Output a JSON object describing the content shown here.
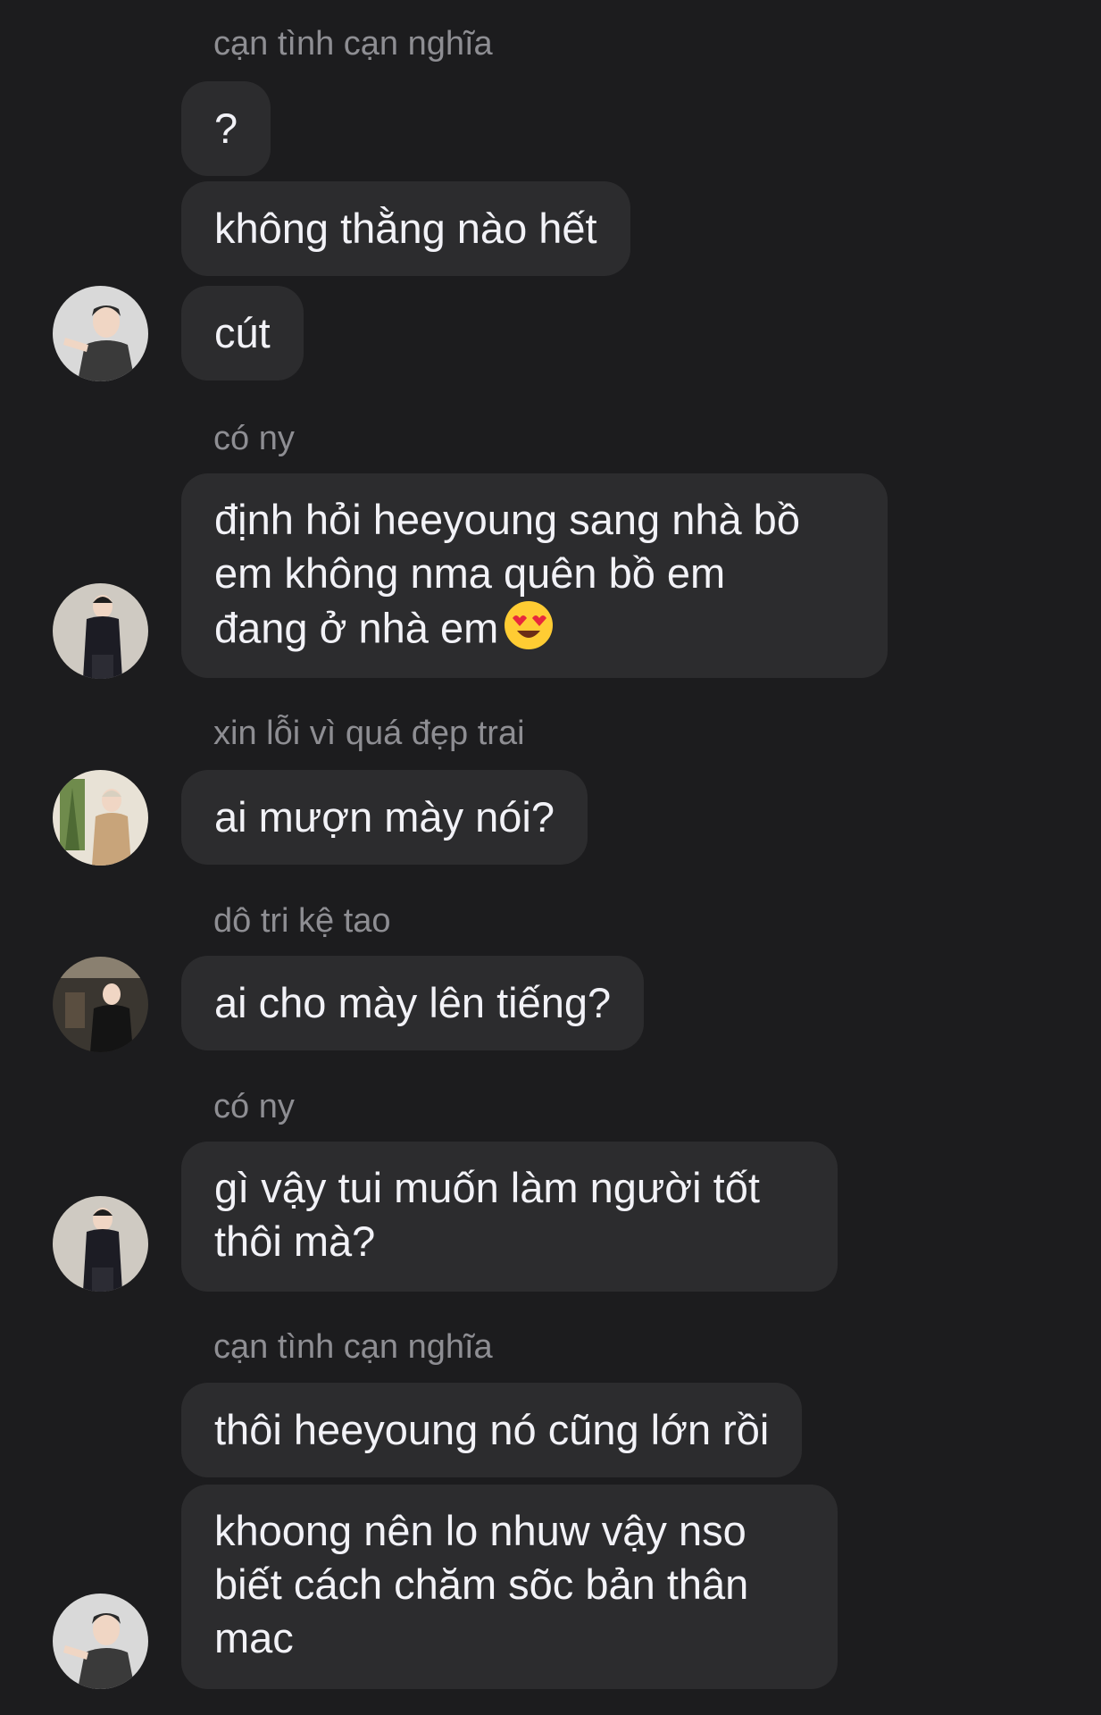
{
  "messages": [
    {
      "sender": "cạn tình cạn nghĩa",
      "bubbles": [
        "?",
        "không thằng nào hết",
        "cút"
      ]
    },
    {
      "sender": "có ny",
      "bubbles": [
        "định hỏi heeyoung sang nhà bồ em không nma quên bồ em đang ở nhà em"
      ],
      "lines": [
        "định hỏi heeyoung sang nhà bồ",
        "em không nma quên bồ em",
        "đang ở nhà em"
      ],
      "emoji": "heart-eyes-emoji"
    },
    {
      "sender": "xin lỗi vì quá đẹp trai",
      "bubbles": [
        "ai mượn mày nói?"
      ]
    },
    {
      "sender": "dô tri kệ tao",
      "bubbles": [
        "ai cho mày lên tiếng?"
      ]
    },
    {
      "sender": "có ny",
      "bubbles": [
        "gì vậy tui muốn làm người tốt thôi mà?"
      ],
      "lines": [
        "gì vậy tui muốn làm người tốt",
        "thôi mà?"
      ]
    },
    {
      "sender": "cạn tình cạn nghĩa",
      "bubbles": [
        "thôi heeyoung nó cũng lớn rồi",
        "khoong nên lo nhuw vậy nso biết cách chăm sõc bản thân mac"
      ],
      "lines": [
        "khoong nên lo nhuw vậy nso",
        "biết cách chăm sõc bản thân",
        "mac"
      ]
    }
  ],
  "colors": {
    "background": "#1c1c1e",
    "bubble": "#2c2c2e",
    "sender_text": "#8e8e93",
    "message_text": "#f2f2f7"
  }
}
